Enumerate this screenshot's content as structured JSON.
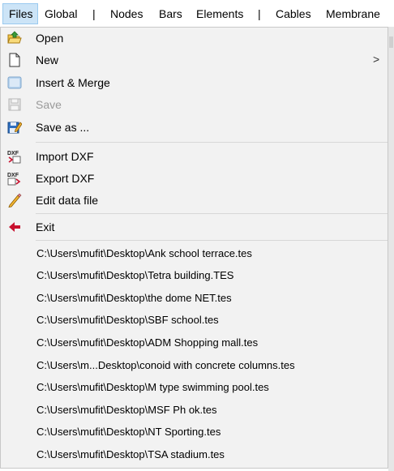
{
  "menubar": {
    "items": [
      "Files",
      "Global",
      "Nodes",
      "Bars",
      "Elements",
      "Cables",
      "Membrane"
    ],
    "separator": "|"
  },
  "files_menu": {
    "open": "Open",
    "new": "New",
    "new_arrow": ">",
    "insert_merge": "Insert & Merge",
    "save": "Save",
    "save_as": "Save as ...",
    "import_dxf": "Import DXF",
    "export_dxf": "Export DXF",
    "edit_data_file": "Edit data file",
    "exit": "Exit",
    "dxf_glyph": "DXF",
    "recent_files": [
      "C:\\Users\\mufit\\Desktop\\Ank school terrace.tes",
      "C:\\Users\\mufit\\Desktop\\Tetra building.TES",
      "C:\\Users\\mufit\\Desktop\\the dome NET.tes",
      "C:\\Users\\mufit\\Desktop\\SBF school.tes",
      "C:\\Users\\mufit\\Desktop\\ADM Shopping mall.tes",
      "C:\\Users\\m...Desktop\\conoid with concrete columns.tes",
      "C:\\Users\\mufit\\Desktop\\M type swimming pool.tes",
      "C:\\Users\\mufit\\Desktop\\MSF Ph ok.tes",
      "C:\\Users\\mufit\\Desktop\\NT Sporting.tes",
      "C:\\Users\\mufit\\Desktop\\TSA stadium.tes"
    ]
  },
  "icons": {
    "open": "folder-open-icon",
    "new": "new-document-icon",
    "insert_merge": "insert-merge-icon",
    "save": "save-disk-icon",
    "save_as": "save-as-icon",
    "import_dxf": "import-dxf-icon",
    "export_dxf": "export-dxf-icon",
    "edit_data_file": "pencil-icon",
    "exit": "exit-arrow-icon"
  },
  "colors": {
    "selected_menu_bg": "#cce4f7",
    "menu_bg": "#f2f2f2",
    "disabled_text": "#9a9a9a",
    "exit_red": "#c8102e"
  }
}
